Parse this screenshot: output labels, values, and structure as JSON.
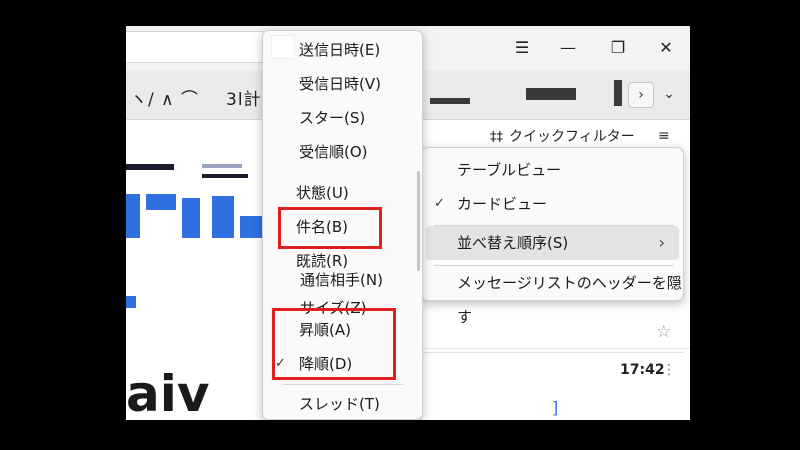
{
  "window": {
    "minimize_icon": "minimize-icon",
    "maximize_icon": "restore-icon",
    "close_icon": "close-icon",
    "menu_icon": "hamburger-icon"
  },
  "toolbar": {
    "fragment_left": "ヽ/ ∧ ⌒",
    "fragment_mid": "3l計"
  },
  "filterbar": {
    "quick_filter_label": "クイックフィルター",
    "quick_filter_icon": "filter-sliders-icon",
    "list_options_icon": "list-options-icon"
  },
  "message_list": {
    "card_time": "17:42",
    "fragment_big": "aiv",
    "fragment_link": "]"
  },
  "sort_menu": {
    "items": [
      {
        "label": "送信日時(E)"
      },
      {
        "label": "受信日時(V)"
      },
      {
        "label": "スター(S)"
      },
      {
        "label": "受信順(O)"
      },
      {
        "label": "状態(U)"
      },
      {
        "label": "件名(B)"
      },
      {
        "label": "既読(R)"
      },
      {
        "label": "通信相手(N)"
      },
      {
        "label": "サイズ(Z)"
      },
      {
        "label": "昇順(A)"
      },
      {
        "label": "降順(D)",
        "checked": true
      },
      {
        "label": "スレッド(T)"
      }
    ]
  },
  "context_menu": {
    "items": [
      {
        "label": "テーブルビュー"
      },
      {
        "label": "カードビュー",
        "checked": true
      },
      {
        "label": "並べ替え順序(S)",
        "submenu": true,
        "highlighted": true
      },
      {
        "label": "メッセージリストのヘッダーを隠す"
      }
    ]
  },
  "colors": {
    "highlight_box": "#e0201e",
    "accent_blue": "#2f6fe0",
    "menu_bg": "#fafafa"
  }
}
